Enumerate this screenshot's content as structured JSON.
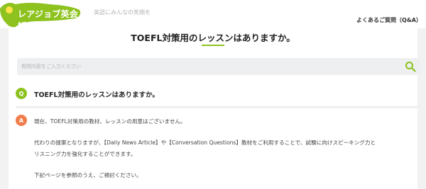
{
  "header": {
    "logo_text": "レアジョブ英会話",
    "sub_text": "英語にみんなの笑顔を",
    "faq_link": "よくあるご質問（Q&A）"
  },
  "page": {
    "title": "TOEFL対策用のレッスンはありますか。"
  },
  "search": {
    "placeholder": "質問内容をご入力ください",
    "icon": "search-icon"
  },
  "qa": {
    "q_badge": "Q",
    "question": "TOEFL対策用のレッスンはありますか。",
    "a_badge": "A",
    "answer_lines": [
      "現在、TOEFL対策用の教材、レッスンの用意はございません。",
      "代わりの提案となりますが、【Daily News Article】や【Conversation Questions】教材をご利用することで、試験に向けスピーキング力と",
      "リスニング力を強化することができます。",
      "下記ページを参照のうえ、ご検討ください。"
    ]
  },
  "colors": {
    "brand_green": "#8dc21f",
    "answer_orange": "#f07d4b"
  }
}
